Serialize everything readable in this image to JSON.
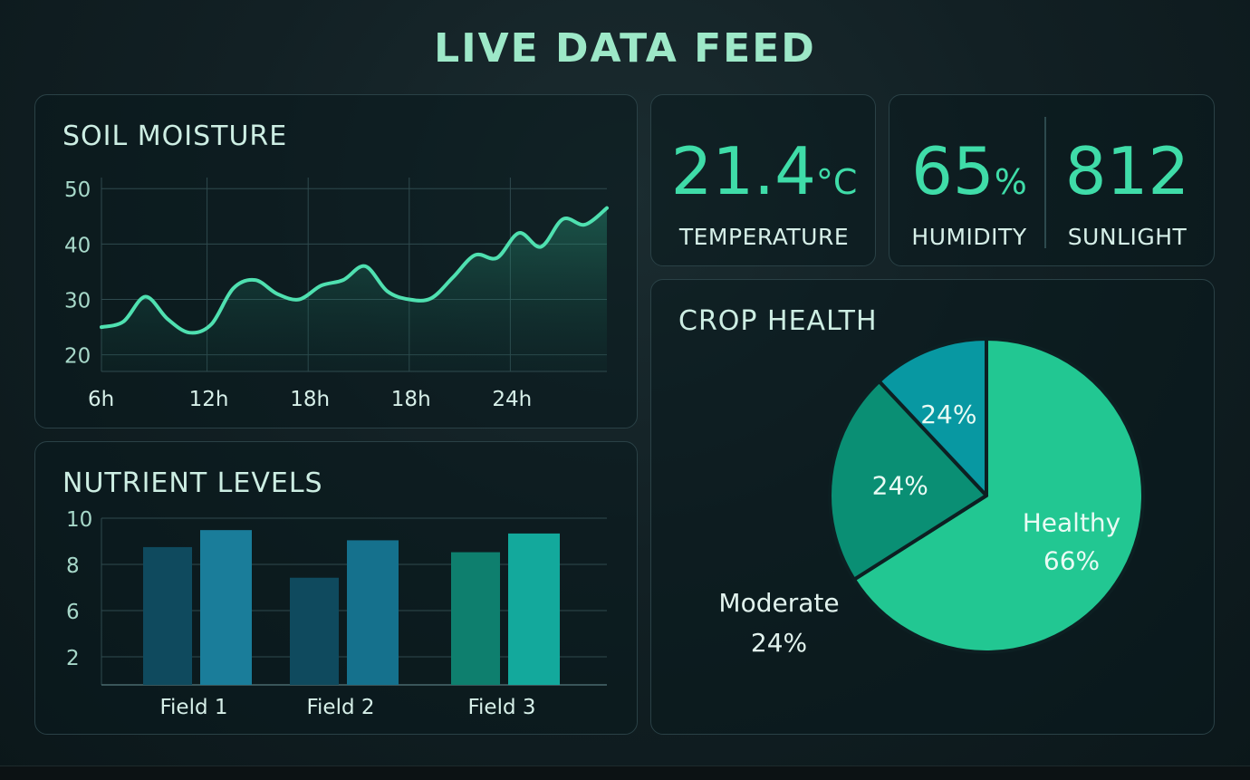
{
  "page": {
    "title": "LIVE DATA FEED"
  },
  "soil_moisture": {
    "title": "SOIL MOISTURE"
  },
  "nutrient_levels": {
    "title": "NUTRIENT LEVELS"
  },
  "crop_health": {
    "title": "CROP HEALTH"
  },
  "stats": {
    "temperature": {
      "value": "21.4",
      "unit": "°C",
      "label": "TEMPERATURE"
    },
    "humidity": {
      "value": "65",
      "unit": "%",
      "label": "HUMIDITY"
    },
    "sunlight": {
      "value": "812",
      "label": "SUNLIGHT"
    }
  },
  "colors": {
    "accent": "#3fdca8",
    "line": "#4fe0b0",
    "grid": "#2f4a4e",
    "axis_text": "#a7d8c9",
    "bar_dark": "#0f4a5e",
    "bar_light": "#1a7d9a",
    "bar_teal_dark": "#0e7f6e",
    "bar_teal_light": "#13a99c",
    "pie_healthy": "#22c792",
    "pie_a": "#0a8f74",
    "pie_b": "#0898a2"
  },
  "chart_data": [
    {
      "id": "soil-moisture",
      "type": "area",
      "title": "SOIL MOISTURE",
      "x_tick_labels": [
        "6h",
        "12h",
        "18h",
        "18h",
        "24h"
      ],
      "y_ticks": [
        20,
        30,
        40,
        50
      ],
      "ylim": [
        17,
        52
      ],
      "grid": true,
      "series": [
        {
          "values": [
            25,
            26,
            30.5,
            26.5,
            24,
            25.5,
            32,
            33.5,
            31,
            30,
            32.5,
            33.5,
            36,
            31.5,
            30,
            30.2,
            34,
            38,
            37.5,
            42,
            39.5,
            44.5,
            43.5,
            46.5
          ]
        }
      ]
    },
    {
      "id": "nutrient-levels",
      "type": "bar",
      "title": "NUTRIENT LEVELS",
      "categories": [
        "Field 1",
        "Field 2",
        "Field 3"
      ],
      "y_tick_labels": [
        "10",
        "8",
        "6",
        "2"
      ],
      "grid": true,
      "series": [
        {
          "values": [
            8.3,
            6.5,
            8.0
          ]
        },
        {
          "values": [
            9.3,
            8.7,
            9.1
          ]
        }
      ]
    },
    {
      "id": "crop-health",
      "type": "pie",
      "title": "CROP HEALTH",
      "slices": [
        {
          "label": "Healthy",
          "value": 66,
          "display": "66%"
        },
        {
          "label": "",
          "value": 22,
          "display": "24%"
        },
        {
          "label": "",
          "value": 12,
          "display": "24%"
        }
      ],
      "outside_label": {
        "label": "Moderate",
        "display": "24%"
      }
    }
  ]
}
